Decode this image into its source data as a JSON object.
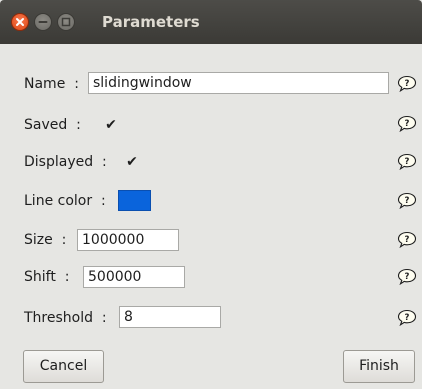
{
  "window": {
    "title": "Parameters"
  },
  "fields": {
    "name": {
      "label": "Name  :",
      "value": "slidingwindow"
    },
    "saved": {
      "label": "Saved  :",
      "checked": true,
      "mark": "✔"
    },
    "displayed": {
      "label": "Displayed  :",
      "checked": true,
      "mark": "✔"
    },
    "line_color": {
      "label": "Line color  :",
      "color": "#0a64dc"
    },
    "size": {
      "label": "Size  :",
      "value": "1000000"
    },
    "shift": {
      "label": "Shift  :",
      "value": "500000"
    },
    "threshold": {
      "label": "Threshold  :",
      "value": "8"
    }
  },
  "help_icon": "help-speech-bubble-icon",
  "buttons": {
    "cancel": "Cancel",
    "finish": "Finish"
  }
}
